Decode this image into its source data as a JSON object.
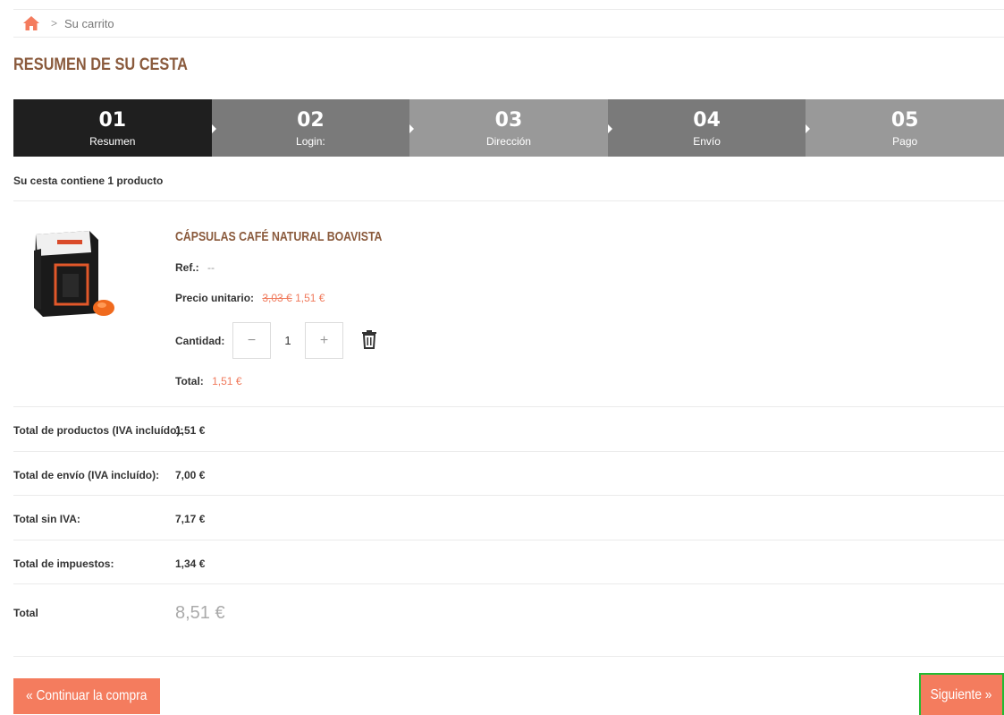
{
  "breadcrumb": {
    "current": "Su carrito",
    "separator": ">"
  },
  "page_title": "RESUMEN DE SU CESTA",
  "steps": [
    {
      "num": "01",
      "label": "Resumen",
      "color": "#1f1f1f"
    },
    {
      "num": "02",
      "label": "Login:",
      "color": "#7a7a7a"
    },
    {
      "num": "03",
      "label": "Dirección",
      "color": "#999999"
    },
    {
      "num": "04",
      "label": "Envío",
      "color": "#7a7a7a"
    },
    {
      "num": "05",
      "label": "Pago",
      "color": "#999999"
    }
  ],
  "cart_count": "Su cesta contiene 1 producto",
  "product": {
    "name": "CÁPSULAS CAFÉ NATURAL BOAVISTA",
    "ref_label": "Ref.:",
    "ref_value": "--",
    "price_label": "Precio unitario:",
    "price_old": "3,03 €",
    "price_new": "1,51 €",
    "qty_label": "Cantidad:",
    "qty_value": "1",
    "qty_minus": "−",
    "qty_plus": "+",
    "total_label": "Total:",
    "total_value": "1,51 €"
  },
  "summary": [
    {
      "label": "Total de productos (IVA incluído):",
      "value": "1,51 €"
    },
    {
      "label": "Total de envío (IVA incluído):",
      "value": "7,00 €"
    },
    {
      "label": "Total sin IVA:",
      "value": "7,17 €"
    },
    {
      "label": "Total de impuestos:",
      "value": "1,34 €"
    }
  ],
  "grand_total": {
    "label": "Total",
    "value": "8,51 €"
  },
  "buttons": {
    "continue": "« Continuar la compra",
    "next": "Siguiente »"
  },
  "colors": {
    "accent": "#f47c5e",
    "title": "#8a5a3c",
    "highlight_border": "#22bb33"
  }
}
